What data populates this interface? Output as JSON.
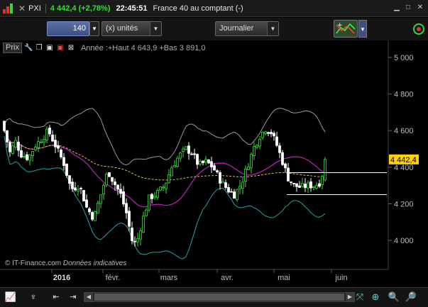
{
  "titlebar": {
    "ticker": "PXI",
    "price": "4 442,4 (+2,78%)",
    "time": "22:45:51",
    "name": "France 40 au comptant (-)"
  },
  "toolbar": {
    "quantity": "140",
    "unit": "(x) unités",
    "period": "Journalier"
  },
  "legend": {
    "label": "Prix",
    "annee": "Année :+Haut 4 643,9 +Bas 3 891,0"
  },
  "watermark": {
    "source": "© IT-Finance.com",
    "note": "Données indicatives"
  },
  "price_tag": "4 442,4",
  "colors": {
    "up": "#2ee02e",
    "down": "#ffffff",
    "bollinger": "#9a9a9a",
    "ma_short": "#c020c0",
    "ma_long": "#d4c24a",
    "lower_band": "#1fa3a3",
    "price_tag_bg": "#ffd100"
  },
  "chart_data": {
    "type": "candlestick",
    "y_ticks": [
      "5 000",
      "4 800",
      "4 600",
      "4 400",
      "4 200",
      "4 000"
    ],
    "x_ticks": [
      "2016",
      "févr.",
      "mars",
      "avr.",
      "mai",
      "juin"
    ],
    "ylim": [
      3870,
      5070
    ],
    "last": 4442.4,
    "horizontal_lines": [
      4370,
      4250
    ],
    "grid": false
  }
}
